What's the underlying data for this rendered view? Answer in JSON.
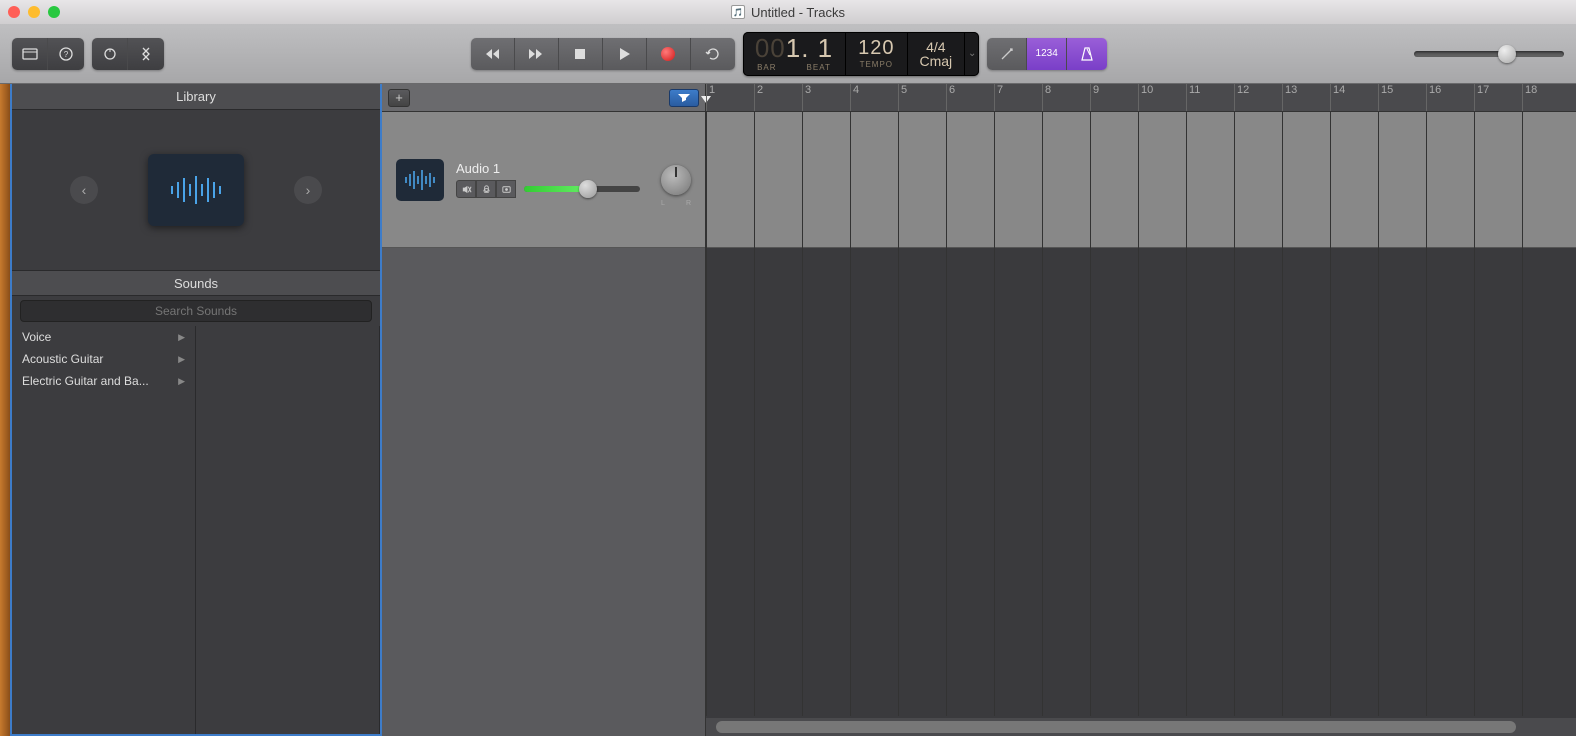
{
  "window": {
    "title": "Untitled - Tracks"
  },
  "lcd": {
    "bar_dim": "00",
    "bar_main": "1. 1",
    "bar_label": "BAR",
    "beat_label": "BEAT",
    "tempo": "120",
    "tempo_label": "TEMPO",
    "signature": "4/4",
    "key": "Cmaj"
  },
  "display_mode": {
    "count_in": "1234"
  },
  "volume": {
    "master_pct": 62
  },
  "library": {
    "header": "Library",
    "sounds_header": "Sounds",
    "search_placeholder": "Search Sounds",
    "categories": [
      "Voice",
      "Acoustic Guitar",
      "Electric Guitar and Ba..."
    ]
  },
  "track": {
    "name": "Audio 1",
    "volume_pct": 55,
    "pan_left": "L",
    "pan_right": "R"
  },
  "ruler": {
    "start": 1,
    "end": 18,
    "spacing_px": 48
  }
}
